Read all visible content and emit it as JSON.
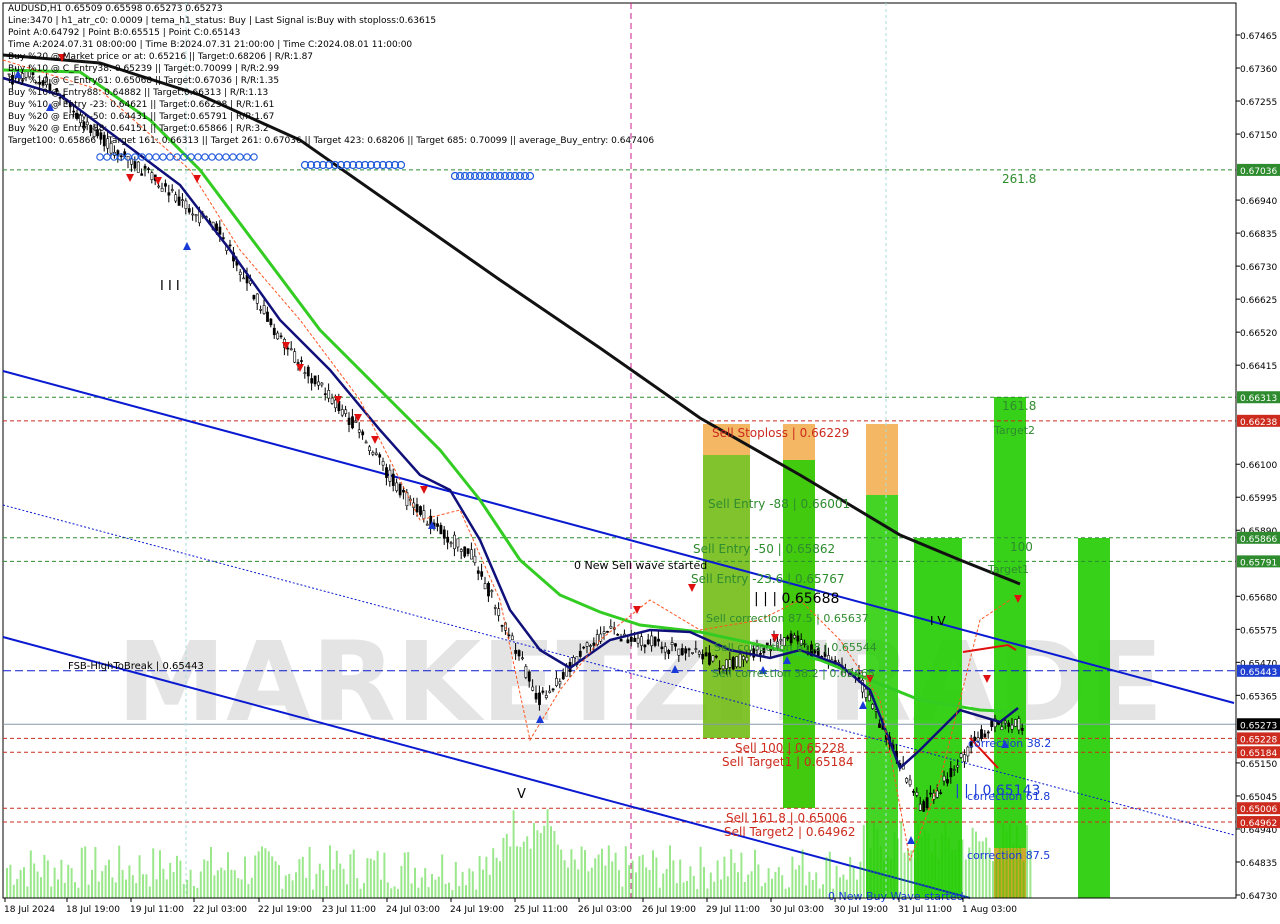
{
  "window": {
    "symbol_line": "AUDUSD,H1  0.65509 0.65598 0.65273 0.65273"
  },
  "info_lines": [
    "Line:3470 | h1_atr_c0: 0.0009 | tema_h1_status: Buy | Last Signal is:Buy with stoploss:0.63615",
    "Point A:0.64792 | Point B:0.65515 | Point C:0.65143",
    "Time A:2024.07.31 08:00:00 | Time B:2024.07.31 21:00:00 | Time C:2024.08.01 11:00:00",
    "Buy %20 @ Market price or at: 0.65216 || Target:0.68206 | R/R:1.87",
    "Buy %10 @ C_Entry38: 0.65239 || Target:0.70099 | R/R:2.99",
    "Buy %10 @ C_Entry61: 0.65068 || Target:0.67036 | R/R:1.35",
    "Buy %10 @ Entry88: 0.64882 || Target:0.66313 | R/R:1.13",
    "Buy %10 @ Entry -23: 0.64621 || Target:0.66238 | R/R:1.61",
    "Buy %20 @ Entry -50: 0.64431 || Target:0.65791 | R/R:1.67",
    "Buy %20 @ Entry -88: 0.64151 || Target:0.65866 | R/R:3.2",
    "Target100: 0.65866 || Target 161: 0.66313 || Target 261: 0.67036 || Target 423: 0.68206 || Target 685: 0.70099 || average_Buy_entry: 0.647406"
  ],
  "price_axis": {
    "ticks": [
      "0.67465",
      "0.67360",
      "0.67255",
      "0.67150",
      "0.66940",
      "0.66835",
      "0.66730",
      "0.66625",
      "0.66520",
      "0.66415",
      "0.66100",
      "0.65995",
      "0.65890",
      "0.65680",
      "0.65575",
      "0.65470",
      "0.65365",
      "0.65150",
      "0.65045",
      "0.64940",
      "0.64835",
      "0.64730"
    ],
    "highlighted": [
      {
        "label": "0.67036",
        "color": "#2e8b2e"
      },
      {
        "label": "0.66313",
        "color": "#2e8b2e"
      },
      {
        "label": "0.66238",
        "color": "#cc2b1e"
      },
      {
        "label": "0.65866",
        "color": "#2e8b2e"
      },
      {
        "label": "0.65791",
        "color": "#2e8b2e"
      },
      {
        "label": "0.65443",
        "color": "#1f3fd1"
      },
      {
        "label": "0.65273",
        "color": "#000000"
      },
      {
        "label": "0.65228",
        "color": "#cc2b1e"
      },
      {
        "label": "0.65184",
        "color": "#cc2b1e"
      },
      {
        "label": "0.65006",
        "color": "#cc2b1e"
      },
      {
        "label": "0.64962",
        "color": "#cc2b1e"
      }
    ]
  },
  "time_axis": [
    "18 Jul 2024",
    "18 Jul 19:00",
    "19 Jul 11:00",
    "22 Jul 03:00",
    "22 Jul 19:00",
    "23 Jul 11:00",
    "24 Jul 03:00",
    "24 Jul 19:00",
    "25 Jul 11:00",
    "26 Jul 03:00",
    "26 Jul 19:00",
    "29 Jul 11:00",
    "30 Jul 03:00",
    "30 Jul 19:00",
    "31 Jul 11:00",
    "1 Aug 03:00"
  ],
  "annotations": {
    "fib_261": "261.8",
    "fib_161": "161.8",
    "target2": "Target2",
    "fib_100": "100",
    "target1": "Target1",
    "sell_stoploss": "Sell Stoploss | 0.66229",
    "sell_entry_88": "Sell Entry -88 | 0.66001",
    "sell_entry_50": "Sell Entry -50 | 0.65862",
    "sell_entry_23": "Sell Entry -23.6 | 0.65767",
    "new_sell_wave": "0 New Sell wave started",
    "level_65688": "| | | 0.65688",
    "sell_corr_875": "Sell correction 87.5 | 0.65637",
    "sell_corr_618": "Sell correction 61.8 | 0.65544",
    "sell_corr_382": "Sell correction 38.2 | 0.65465",
    "fsb": "FSB-HighToBreak | 0.65443",
    "sell_100": "Sell 100 | 0.65228",
    "sell_target1": "Sell Target1 | 0.65184",
    "sell_1618": "Sell 161.8 | 0.65006",
    "sell_target2": "Sell Target2 | 0.64962",
    "corr_382": "correction 38.2",
    "level_65143": "| | | 0.65143",
    "corr_618": "correction 61.8",
    "corr_875": "correction 87.5",
    "new_buy_wave": "0 New Buy Wave started",
    "wave_iv": "I V",
    "wave_v": "V",
    "wave_iii": "I I I"
  },
  "watermark": "MARKETZITRADE",
  "colors": {
    "bull_box": "#22cc00",
    "bear_box": "#f0a030",
    "level_green": "#2e8b2e",
    "level_red": "#cc2b1e",
    "channel": "#0a1ad0",
    "ma_fast": "#10107a",
    "ma_mid": "#33cc22",
    "ma_slow": "#111111",
    "envelope": "#ff5522"
  },
  "chart_data": {
    "type": "candlestick",
    "symbol": "AUDUSD",
    "timeframe": "H1",
    "ohlc_last": {
      "open": 0.65509,
      "high": 0.65598,
      "low": 0.65273,
      "close": 0.65273
    },
    "ylim": [
      0.6472,
      0.6755
    ],
    "horizontal_levels": [
      0.67036,
      0.66313,
      0.66238,
      0.65866,
      0.65791,
      0.65443,
      0.65273,
      0.65228,
      0.65184,
      0.65006,
      0.64962
    ],
    "close_path": [
      {
        "t": "18 Jul 2024",
        "price": 0.6733
      },
      {
        "t": "18 Jul 19:00",
        "price": 0.6714
      },
      {
        "t": "19 Jul 11:00",
        "price": 0.67
      },
      {
        "t": "22 Jul 03:00",
        "price": 0.6684
      },
      {
        "t": "22 Jul 19:00",
        "price": 0.6648
      },
      {
        "t": "23 Jul 11:00",
        "price": 0.6625
      },
      {
        "t": "24 Jul 03:00",
        "price": 0.6597
      },
      {
        "t": "24 Jul 19:00",
        "price": 0.658
      },
      {
        "t": "25 Jul 11:00",
        "price": 0.6535
      },
      {
        "t": "26 Jul 03:00",
        "price": 0.6557
      },
      {
        "t": "26 Jul 19:00",
        "price": 0.6552
      },
      {
        "t": "29 Jul 11:00",
        "price": 0.6546
      },
      {
        "t": "30 Jul 03:00",
        "price": 0.6555
      },
      {
        "t": "30 Jul 19:00",
        "price": 0.6542
      },
      {
        "t": "31 Jul 11:00",
        "price": 0.65
      },
      {
        "t": "1 Aug 03:00",
        "price": 0.6527
      }
    ]
  }
}
